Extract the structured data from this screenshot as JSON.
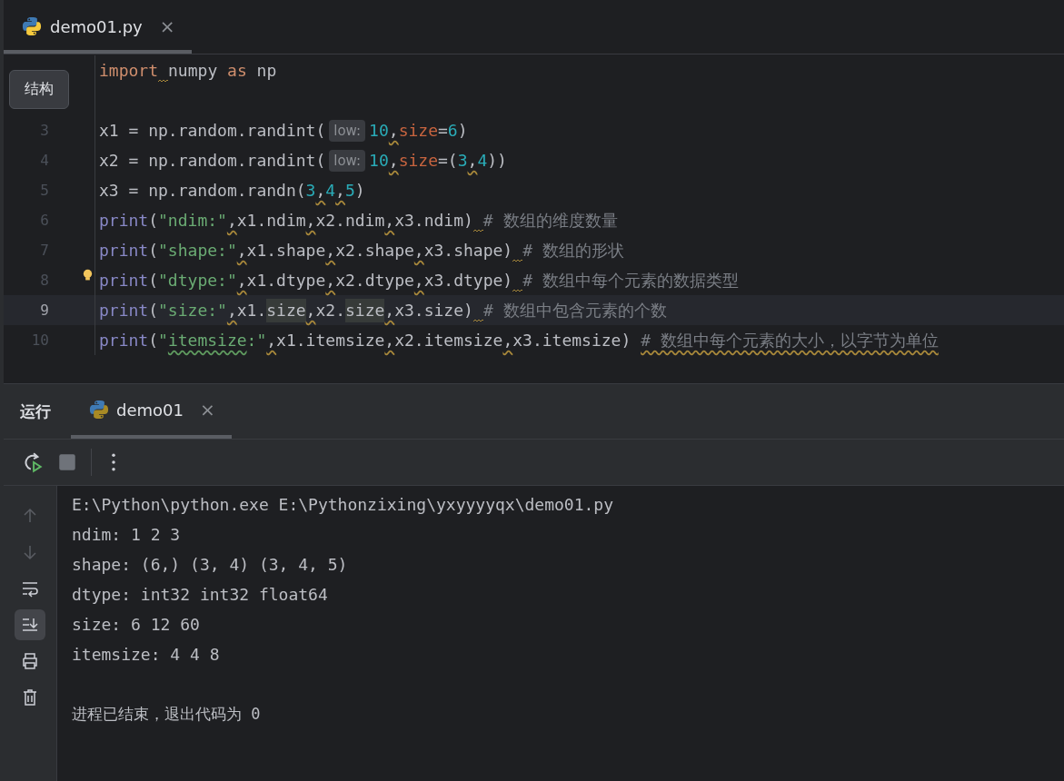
{
  "editor_tab": {
    "label": "demo01.py",
    "close": "×",
    "selected": true
  },
  "tooltip": "结构",
  "code_lines": [
    {
      "current": false,
      "tokens": [
        {
          "kind": "keyword",
          "text": "import",
          "gap_warning": true
        },
        {
          "kind": "plain",
          "text": "numpy "
        },
        {
          "kind": "keyword",
          "text": "as"
        },
        {
          "kind": "plain",
          "text": " np"
        }
      ]
    },
    {
      "current": false
    },
    {
      "number": "3",
      "current": false,
      "tokens": [
        {
          "kind": "plain",
          "text": "x1 = np.random.randint("
        },
        {
          "kind": "hint",
          "text": "low:"
        },
        {
          "kind": "number",
          "text": "10"
        },
        {
          "kind": "plain",
          "text": ",",
          "warning": true
        },
        {
          "kind": "param",
          "text": "size"
        },
        {
          "kind": "plain",
          "text": "="
        },
        {
          "kind": "number",
          "text": "6"
        },
        {
          "kind": "plain",
          "text": ")"
        }
      ]
    },
    {
      "number": "4",
      "current": false,
      "tokens": [
        {
          "kind": "plain",
          "text": "x2 = np.random.randint("
        },
        {
          "kind": "hint",
          "text": "low:"
        },
        {
          "kind": "number",
          "text": "10"
        },
        {
          "kind": "plain",
          "text": ",",
          "warning": true
        },
        {
          "kind": "param",
          "text": "size"
        },
        {
          "kind": "plain",
          "text": "=("
        },
        {
          "kind": "number",
          "text": "3"
        },
        {
          "kind": "plain",
          "text": ",",
          "warning": true
        },
        {
          "kind": "number",
          "text": "4"
        },
        {
          "kind": "plain",
          "text": "))"
        }
      ]
    },
    {
      "number": "5",
      "current": false,
      "tokens": [
        {
          "kind": "plain",
          "text": "x3 = np.random.randn("
        },
        {
          "kind": "number",
          "text": "3"
        },
        {
          "kind": "plain",
          "text": ",",
          "warning": true
        },
        {
          "kind": "number",
          "text": "4"
        },
        {
          "kind": "plain",
          "text": ",",
          "warning": true
        },
        {
          "kind": "number",
          "text": "5"
        },
        {
          "kind": "plain",
          "text": ")"
        }
      ]
    },
    {
      "number": "6",
      "current": false,
      "tokens": [
        {
          "kind": "func",
          "text": "print"
        },
        {
          "kind": "plain",
          "text": "("
        },
        {
          "kind": "string",
          "text": "\"ndim:\""
        },
        {
          "kind": "plain",
          "text": ",",
          "warning": true
        },
        {
          "kind": "plain",
          "text": "x1.ndim"
        },
        {
          "kind": "plain",
          "text": ",",
          "warning": true
        },
        {
          "kind": "plain",
          "text": "x2.ndim"
        },
        {
          "kind": "plain",
          "text": ",",
          "warning": true
        },
        {
          "kind": "plain",
          "text": "x3.ndim)",
          "gap_warning": true
        },
        {
          "kind": "comment",
          "text": "# 数组的维度数量"
        }
      ]
    },
    {
      "number": "7",
      "current": false,
      "tokens": [
        {
          "kind": "func",
          "text": "print"
        },
        {
          "kind": "plain",
          "text": "("
        },
        {
          "kind": "string",
          "text": "\"shape:\""
        },
        {
          "kind": "plain",
          "text": ",",
          "warning": true
        },
        {
          "kind": "plain",
          "text": "x1.shape"
        },
        {
          "kind": "plain",
          "text": ",",
          "warning": true
        },
        {
          "kind": "plain",
          "text": "x2.shape"
        },
        {
          "kind": "plain",
          "text": ",",
          "warning": true
        },
        {
          "kind": "plain",
          "text": "x3.shape)",
          "gap_warning": true
        },
        {
          "kind": "comment",
          "text": "# 数组的形状"
        }
      ]
    },
    {
      "number": "8",
      "current": false,
      "bulb": true,
      "tokens": [
        {
          "kind": "func",
          "text": "print"
        },
        {
          "kind": "plain",
          "text": "("
        },
        {
          "kind": "string",
          "text": "\"dtype:\""
        },
        {
          "kind": "plain",
          "text": ",",
          "warning": true
        },
        {
          "kind": "plain",
          "text": "x1.dtype"
        },
        {
          "kind": "plain",
          "text": ",",
          "warning": true
        },
        {
          "kind": "plain",
          "text": "x2.dtype"
        },
        {
          "kind": "plain",
          "text": ",",
          "warning": true
        },
        {
          "kind": "plain",
          "text": "x3.dtype)",
          "gap_warning": true
        },
        {
          "kind": "comment",
          "text": "# 数组中每个元素的数据类型"
        }
      ]
    },
    {
      "number": "9",
      "current": true,
      "tokens": [
        {
          "kind": "func",
          "text": "print"
        },
        {
          "kind": "plain",
          "text": "("
        },
        {
          "kind": "string",
          "text": "\"size:\""
        },
        {
          "kind": "plain",
          "text": ",",
          "warning": true
        },
        {
          "kind": "plain",
          "text": "x1."
        },
        {
          "kind": "plain",
          "text": "size",
          "usage": true
        },
        {
          "kind": "plain",
          "text": ",",
          "warning": true
        },
        {
          "kind": "plain",
          "text": "x2."
        },
        {
          "kind": "plain",
          "text": "size",
          "usage": true
        },
        {
          "kind": "plain",
          "text": ",",
          "warning": true
        },
        {
          "kind": "plain",
          "text": "x3.size)",
          "gap_warning": true
        },
        {
          "kind": "comment",
          "text": "# 数组中包含元素的个数"
        }
      ]
    },
    {
      "number": "10",
      "current": false,
      "tokens": [
        {
          "kind": "func",
          "text": "print"
        },
        {
          "kind": "plain",
          "text": "("
        },
        {
          "kind": "string",
          "text": "\""
        },
        {
          "kind": "string",
          "text": "itemsize",
          "typo": true
        },
        {
          "kind": "string",
          "text": ":\""
        },
        {
          "kind": "plain",
          "text": ",",
          "warning": true
        },
        {
          "kind": "plain",
          "text": "x1.itemsize"
        },
        {
          "kind": "plain",
          "text": ",",
          "warning": true
        },
        {
          "kind": "plain",
          "text": "x2.itemsize"
        },
        {
          "kind": "plain",
          "text": ",",
          "warning": true
        },
        {
          "kind": "plain",
          "text": "x3.itemsize) "
        },
        {
          "kind": "comment",
          "text": "# 数组中每个元素的大小，以字节为单位",
          "warning": true
        }
      ]
    }
  ],
  "run_panel": {
    "title": "运行",
    "tab": {
      "label": "demo01",
      "close": "×",
      "selected": true
    },
    "toolbar": [
      {
        "kind": "rerun"
      },
      {
        "kind": "stop",
        "disabled": true
      },
      {
        "kind": "more"
      }
    ],
    "side_tools": [
      {
        "kind": "up",
        "disabled": true,
        "on": false
      },
      {
        "kind": "down",
        "disabled": true,
        "on": false
      },
      {
        "kind": "wrap",
        "disabled": false,
        "on": false
      },
      {
        "kind": "scroll-end",
        "disabled": false,
        "on": true
      },
      {
        "kind": "print",
        "disabled": false,
        "on": false
      },
      {
        "kind": "trash",
        "disabled": false,
        "on": false
      }
    ],
    "command": "E:\\Python\\python.exe E:\\Pythonzixing\\yxyyyyqx\\demo01.py",
    "output": [
      "ndim: 1 2 3",
      "shape: (6,) (3, 4) (3, 4, 5)",
      "dtype: int32 int32 float64",
      "size: 6 12 60",
      "itemsize: 4 4 8"
    ],
    "exit_message": "进程已结束，退出代码为 0"
  }
}
